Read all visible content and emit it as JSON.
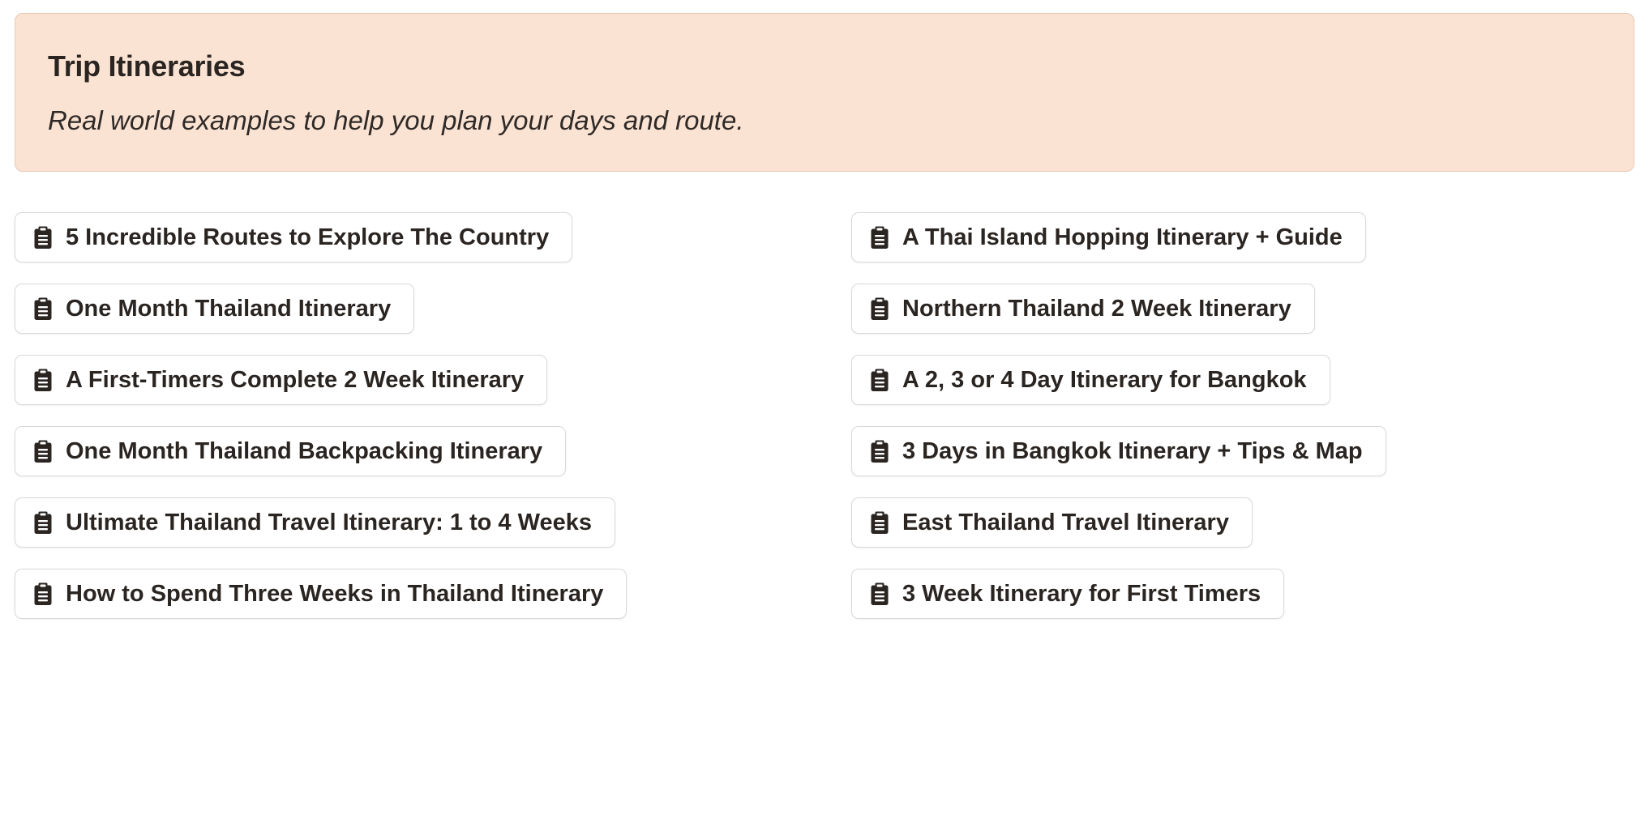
{
  "header": {
    "title": "Trip Itineraries",
    "subtitle": "Real world examples to help you plan your days and route."
  },
  "colors": {
    "banner_bg": "#fbe3d3",
    "banner_border": "#e8c8b4",
    "text": "#2b2522"
  },
  "icon_name": "clipboard-icon",
  "links_left": [
    {
      "label": "5 Incredible Routes to Explore The Country"
    },
    {
      "label": "One Month Thailand Itinerary"
    },
    {
      "label": "A First-Timers Complete 2 Week Itinerary"
    },
    {
      "label": "One Month Thailand Backpacking Itinerary"
    },
    {
      "label": "Ultimate Thailand Travel Itinerary: 1 to 4 Weeks"
    },
    {
      "label": "How to Spend Three Weeks in Thailand Itinerary"
    }
  ],
  "links_right": [
    {
      "label": "A Thai Island Hopping Itinerary + Guide"
    },
    {
      "label": "Northern Thailand 2 Week Itinerary"
    },
    {
      "label": "A 2, 3 or 4 Day Itinerary for Bangkok"
    },
    {
      "label": "3 Days in Bangkok Itinerary + Tips & Map"
    },
    {
      "label": "East Thailand Travel Itinerary"
    },
    {
      "label": "3 Week Itinerary for First Timers"
    }
  ]
}
